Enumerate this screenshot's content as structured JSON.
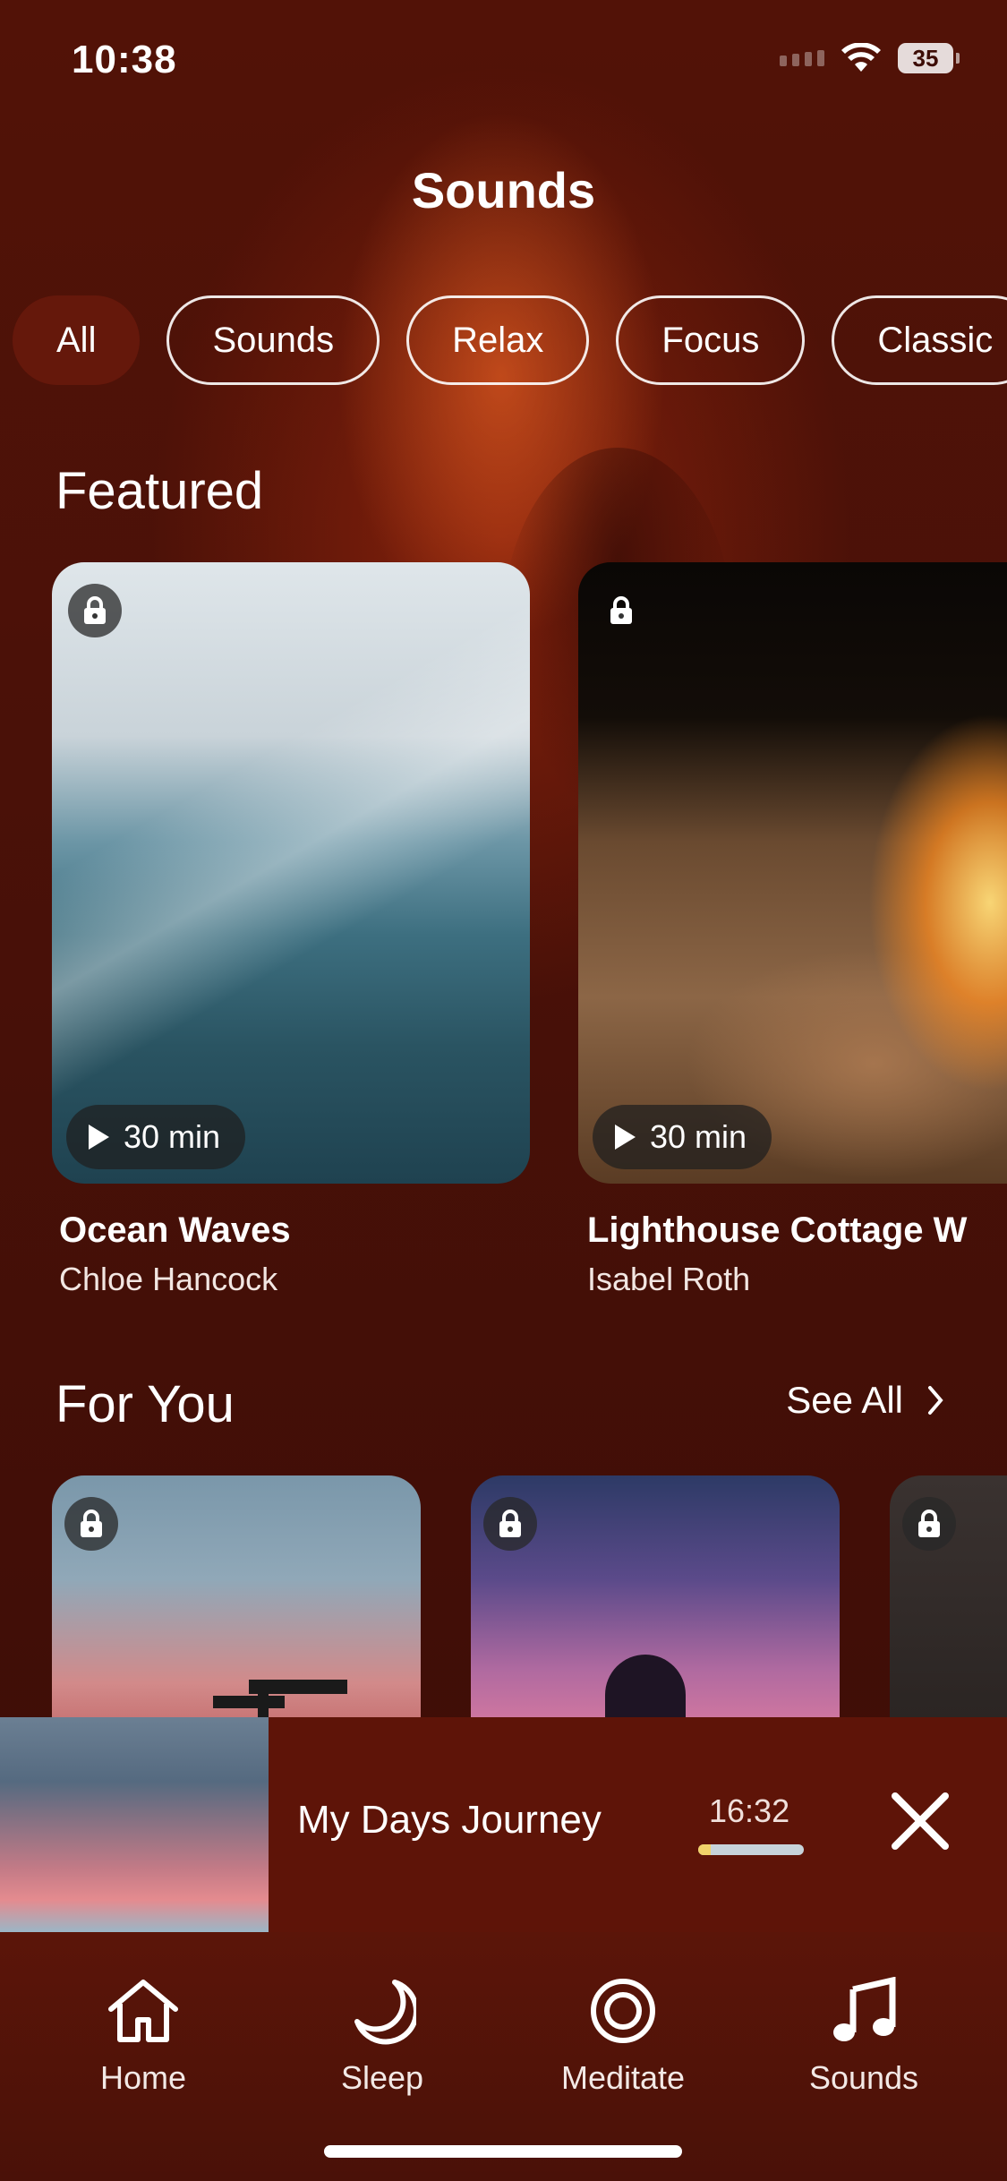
{
  "status_bar": {
    "time": "10:38",
    "battery": "35"
  },
  "page_title": "Sounds",
  "filters": [
    "All",
    "Sounds",
    "Relax",
    "Focus",
    "Classic"
  ],
  "featured": {
    "title": "Featured",
    "cards": [
      {
        "title": "Ocean Waves",
        "author": "Chloe Hancock",
        "duration": "30 min"
      },
      {
        "title": "Lighthouse Cottage W",
        "author": "Isabel Roth",
        "duration": "30 min"
      }
    ]
  },
  "for_you": {
    "title": "For You",
    "see_all": "See All"
  },
  "player": {
    "title": "My Days Journey",
    "time": "16:32",
    "progress": 0.12
  },
  "tabs": [
    "Home",
    "Sleep",
    "Meditate",
    "Sounds"
  ]
}
